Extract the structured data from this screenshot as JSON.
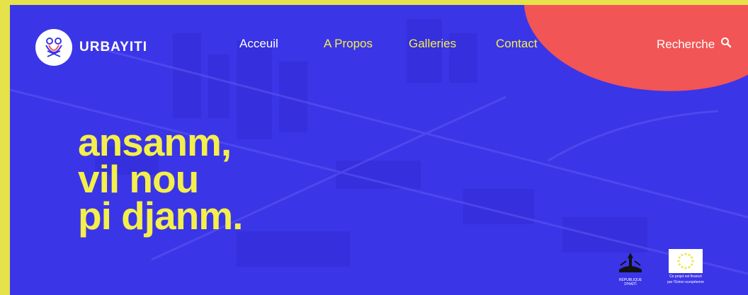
{
  "brand": {
    "name": "URBAYITI"
  },
  "nav": {
    "items": [
      {
        "label": "Acceuil"
      },
      {
        "label": "A Propos"
      },
      {
        "label": "Galleries"
      },
      {
        "label": "Contact"
      }
    ],
    "search_label": "Recherche"
  },
  "hero": {
    "lines": [
      "ansanm,",
      "vil nou",
      "pi djanm."
    ]
  },
  "footer_badges": {
    "haiti_caption": "RÉPUBLIQUE D'HAÏTI",
    "eu_caption_line1": "Ce projet est financé",
    "eu_caption_line2": "par l'Union européenne"
  },
  "colors": {
    "background": "#3b35e8",
    "accent_yellow": "#f4ef4a",
    "accent_red": "#f25555",
    "frame": "#e6e24a"
  },
  "icons": {
    "logo": "urbayiti-logo-icon",
    "search": "search-icon",
    "haiti_coat_of_arms": "haiti-coat-of-arms-icon",
    "eu_flag": "eu-flag-icon"
  }
}
